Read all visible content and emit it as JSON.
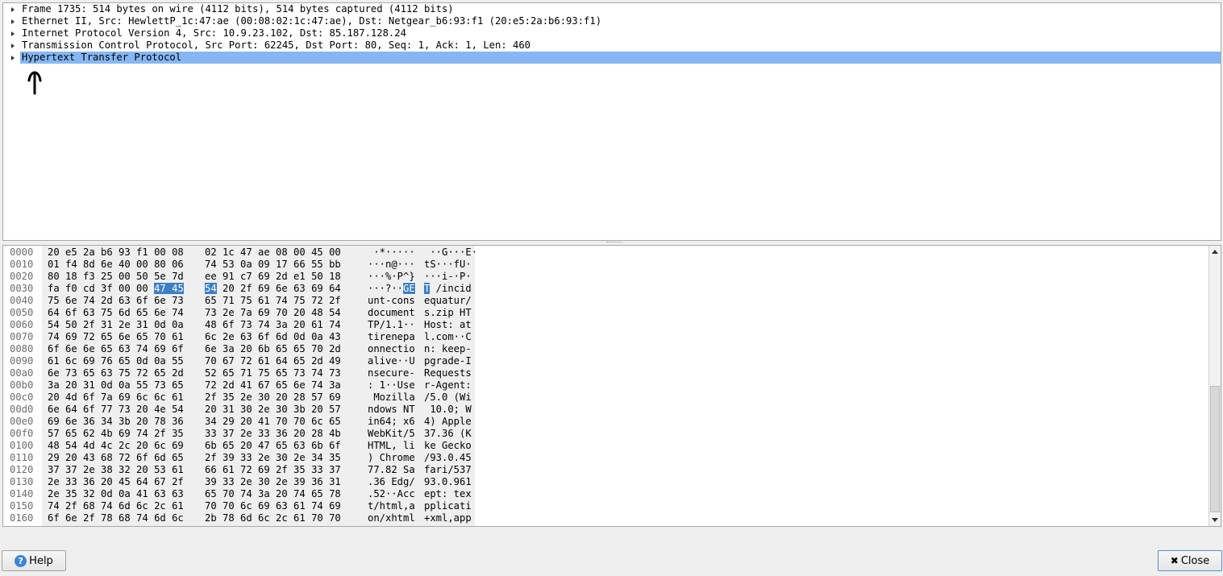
{
  "tree": {
    "rows": [
      {
        "label": "Frame 1735: 514 bytes on wire (4112 bits), 514 bytes captured (4112 bits)",
        "selected": false
      },
      {
        "label": "Ethernet II, Src: HewlettP_1c:47:ae (00:08:02:1c:47:ae), Dst: Netgear_b6:93:f1 (20:e5:2a:b6:93:f1)",
        "selected": false
      },
      {
        "label": "Internet Protocol Version 4, Src: 10.9.23.102, Dst: 85.187.128.24",
        "selected": false
      },
      {
        "label": "Transmission Control Protocol, Src Port: 62245, Dst Port: 80, Seq: 1, Ack: 1, Len: 460",
        "selected": false
      },
      {
        "label": "Hypertext Transfer Protocol",
        "selected": true
      }
    ]
  },
  "hex": {
    "lines": [
      {
        "offset": "0000",
        "hex1": "20 e5 2a b6 93 f1 00 08",
        "hex2": "02 1c 47 ae 08 00 45 00",
        "ascii1": " ·*·····",
        "ascii2": " ··G···E·"
      },
      {
        "offset": "0010",
        "hex1": "01 f4 8d 6e 40 00 80 06",
        "hex2": "74 53 0a 09 17 66 55 bb",
        "ascii1": "···n@···",
        "ascii2": "tS···fU·"
      },
      {
        "offset": "0020",
        "hex1": "80 18 f3 25 00 50 5e 7d",
        "hex2": "ee 91 c7 69 2d e1 50 18",
        "ascii1": "···%·P^}",
        "ascii2": "···i-·P·"
      },
      {
        "offset": "0030",
        "hex1": "fa f0 cd 3f 00 00",
        "hex1_hl": "47 45",
        "hex2_hl": "54",
        "hex2": " 20 2f 69 6e 63 69 64",
        "ascii1": "···?··",
        "ascii1_hl": "GE",
        "ascii2_hl": "T",
        "ascii2": " /incid"
      },
      {
        "offset": "0040",
        "hex1": "75 6e 74 2d 63 6f 6e 73",
        "hex2": "65 71 75 61 74 75 72 2f",
        "ascii1": "unt-cons",
        "ascii2": "equatur/"
      },
      {
        "offset": "0050",
        "hex1": "64 6f 63 75 6d 65 6e 74",
        "hex2": "73 2e 7a 69 70 20 48 54",
        "ascii1": "document",
        "ascii2": "s.zip HT"
      },
      {
        "offset": "0060",
        "hex1": "54 50 2f 31 2e 31 0d 0a",
        "hex2": "48 6f 73 74 3a 20 61 74",
        "ascii1": "TP/1.1··",
        "ascii2": "Host: at"
      },
      {
        "offset": "0070",
        "hex1": "74 69 72 65 6e 65 70 61",
        "hex2": "6c 2e 63 6f 6d 0d 0a 43",
        "ascii1": "tirenepa",
        "ascii2": "l.com··C"
      },
      {
        "offset": "0080",
        "hex1": "6f 6e 6e 65 63 74 69 6f",
        "hex2": "6e 3a 20 6b 65 65 70 2d",
        "ascii1": "onnectio",
        "ascii2": "n: keep-"
      },
      {
        "offset": "0090",
        "hex1": "61 6c 69 76 65 0d 0a 55",
        "hex2": "70 67 72 61 64 65 2d 49",
        "ascii1": "alive··U",
        "ascii2": "pgrade-I"
      },
      {
        "offset": "00a0",
        "hex1": "6e 73 65 63 75 72 65 2d",
        "hex2": "52 65 71 75 65 73 74 73",
        "ascii1": "nsecure-",
        "ascii2": "Requests"
      },
      {
        "offset": "00b0",
        "hex1": "3a 20 31 0d 0a 55 73 65",
        "hex2": "72 2d 41 67 65 6e 74 3a",
        "ascii1": ": 1··Use",
        "ascii2": "r-Agent:"
      },
      {
        "offset": "00c0",
        "hex1": "20 4d 6f 7a 69 6c 6c 61",
        "hex2": "2f 35 2e 30 20 28 57 69",
        "ascii1": " Mozilla",
        "ascii2": "/5.0 (Wi"
      },
      {
        "offset": "00d0",
        "hex1": "6e 64 6f 77 73 20 4e 54",
        "hex2": "20 31 30 2e 30 3b 20 57",
        "ascii1": "ndows NT",
        "ascii2": " 10.0; W"
      },
      {
        "offset": "00e0",
        "hex1": "69 6e 36 34 3b 20 78 36",
        "hex2": "34 29 20 41 70 70 6c 65",
        "ascii1": "in64; x6",
        "ascii2": "4) Apple"
      },
      {
        "offset": "00f0",
        "hex1": "57 65 62 4b 69 74 2f 35",
        "hex2": "33 37 2e 33 36 20 28 4b",
        "ascii1": "WebKit/5",
        "ascii2": "37.36 (K"
      },
      {
        "offset": "0100",
        "hex1": "48 54 4d 4c 2c 20 6c 69",
        "hex2": "6b 65 20 47 65 63 6b 6f",
        "ascii1": "HTML, li",
        "ascii2": "ke Gecko"
      },
      {
        "offset": "0110",
        "hex1": "29 20 43 68 72 6f 6d 65",
        "hex2": "2f 39 33 2e 30 2e 34 35",
        "ascii1": ") Chrome",
        "ascii2": "/93.0.45"
      },
      {
        "offset": "0120",
        "hex1": "37 37 2e 38 32 20 53 61",
        "hex2": "66 61 72 69 2f 35 33 37",
        "ascii1": "77.82 Sa",
        "ascii2": "fari/537"
      },
      {
        "offset": "0130",
        "hex1": "2e 33 36 20 45 64 67 2f",
        "hex2": "39 33 2e 30 2e 39 36 31",
        "ascii1": ".36 Edg/",
        "ascii2": "93.0.961"
      },
      {
        "offset": "0140",
        "hex1": "2e 35 32 0d 0a 41 63 63",
        "hex2": "65 70 74 3a 20 74 65 78",
        "ascii1": ".52··Acc",
        "ascii2": "ept: tex"
      },
      {
        "offset": "0150",
        "hex1": "74 2f 68 74 6d 6c 2c 61",
        "hex2": "70 70 6c 69 63 61 74 69",
        "ascii1": "t/html,a",
        "ascii2": "pplicati"
      },
      {
        "offset": "0160",
        "hex1": "6f 6e 2f 78 68 74 6d 6c",
        "hex2": "2b 78 6d 6c 2c 61 70 70",
        "ascii1": "on/xhtml",
        "ascii2": "+xml,app"
      }
    ]
  },
  "buttons": {
    "help_label": "Help",
    "close_label": "Close"
  },
  "icons": {
    "help": "help-icon",
    "close": "close-icon",
    "expander": "triangle-right-icon",
    "cursor": "hand-cursor-icon"
  },
  "colors": {
    "selection": "#86b7f3",
    "byte_highlight": "#3c7fc3"
  }
}
